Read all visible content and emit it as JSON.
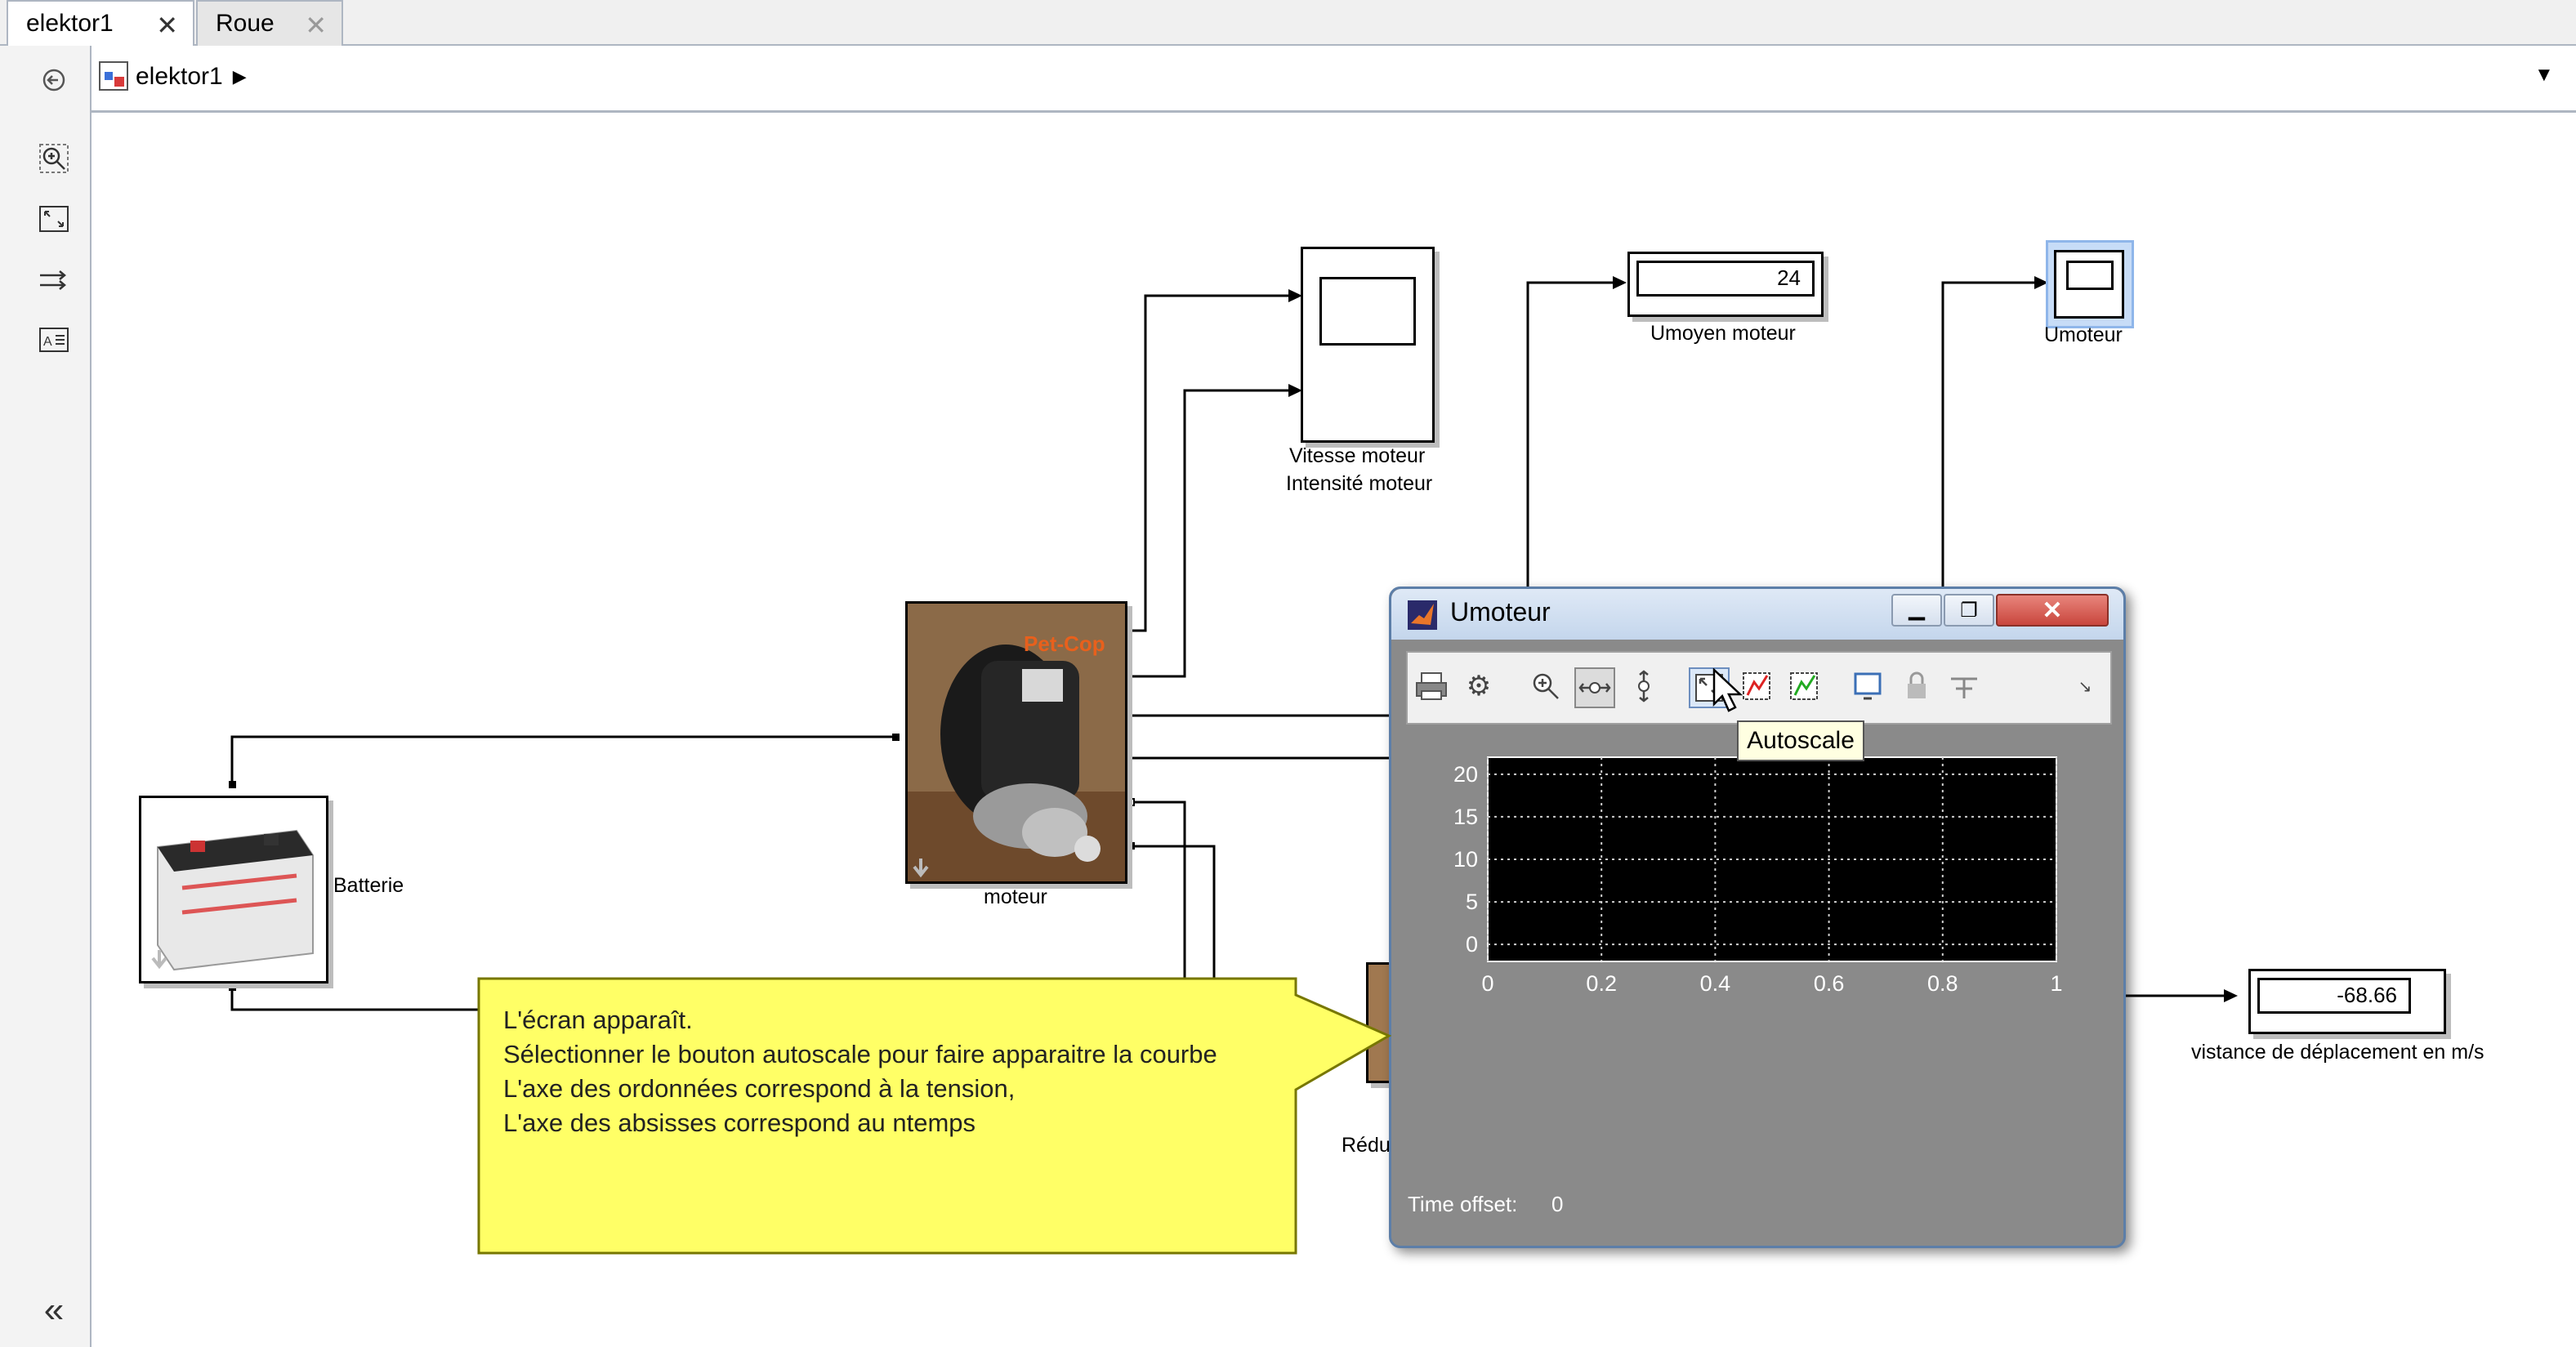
{
  "tabs": [
    {
      "label": "elektor1"
    },
    {
      "label": "Roue"
    }
  ],
  "address": {
    "label": "elektor1"
  },
  "blocks": {
    "scope_vitesse_label_1": "Vitesse moteur",
    "scope_vitesse_label_2": "Intensité moteur",
    "display_umoyen_value": "24",
    "display_umoyen_label": "Umoyen moteur",
    "scope_umoteur_label": "Umoteur",
    "moteur_label": "moteur",
    "moteur_image_text": "Pet-Cop",
    "batterie_label": "Batterie",
    "reducteur_label_partial": "Rédu",
    "display_vitesse_value": "-68.66",
    "display_vitesse_label": "vistance de déplacement en m/s"
  },
  "scope_window": {
    "title": "Umoteur",
    "tooltip": "Autoscale",
    "time_offset_label": "Time offset:",
    "time_offset_value": "0"
  },
  "callout": {
    "line1": "L'écran apparaît.",
    "line2": "Sélectionner le bouton autoscale pour faire apparaitre la courbe",
    "line3": "L'axe des ordonnées correspond à la tension,",
    "line4": "L'axe des absisses correspond au ntemps"
  },
  "chart_data": {
    "type": "line",
    "title": "",
    "xlabel": "",
    "ylabel": "",
    "xlim": [
      0,
      1
    ],
    "ylim": [
      -2,
      22
    ],
    "xticks": [
      "0",
      "0.2",
      "0.4",
      "0.6",
      "0.8",
      "1"
    ],
    "yticks": [
      "0",
      "5",
      "10",
      "15",
      "20"
    ],
    "grid": true,
    "series": []
  },
  "colors": {
    "callout_fill": "#ffff66",
    "callout_border": "#888800",
    "scope_bg": "#8a8a8a",
    "plot_bg": "#000000",
    "close_button": "#c9463d"
  }
}
